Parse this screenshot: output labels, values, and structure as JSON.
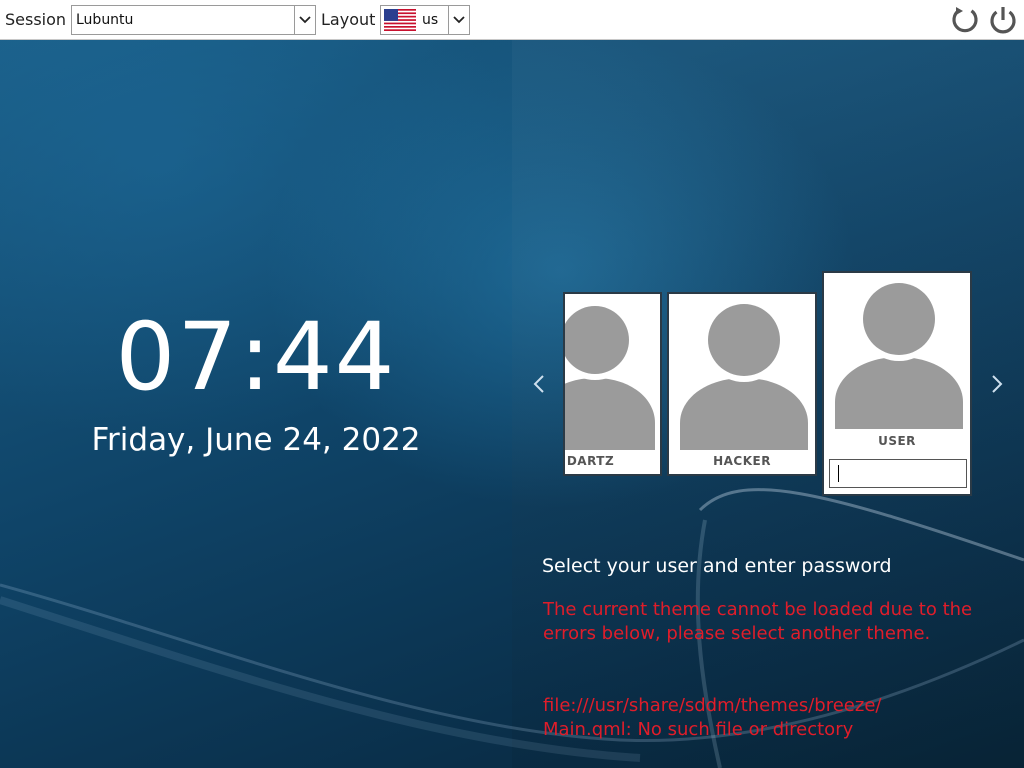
{
  "topbar": {
    "session_label": "Session",
    "session_value": "Lubuntu",
    "layout_label": "Layout",
    "layout_value": "us",
    "layout_flag_icon": "us-flag-icon",
    "reboot_icon": "reboot-icon",
    "shutdown_icon": "power-icon"
  },
  "clock": {
    "time": "07:44",
    "date": "Friday, June 24, 2022"
  },
  "users": [
    {
      "name": "DARTZ"
    },
    {
      "name": "HACKER"
    },
    {
      "name": "USER"
    }
  ],
  "password_input": {
    "value": ""
  },
  "prompt": "Select your user and enter password",
  "error": {
    "line1": "The current theme cannot be loaded due to the errors below, please select another theme.",
    "line2": "file:///usr/share/sddm/themes/breeze/ Main.qml: No such file or directory"
  },
  "colors": {
    "error": "#e01d2a",
    "avatar": "#9b9b9b"
  }
}
